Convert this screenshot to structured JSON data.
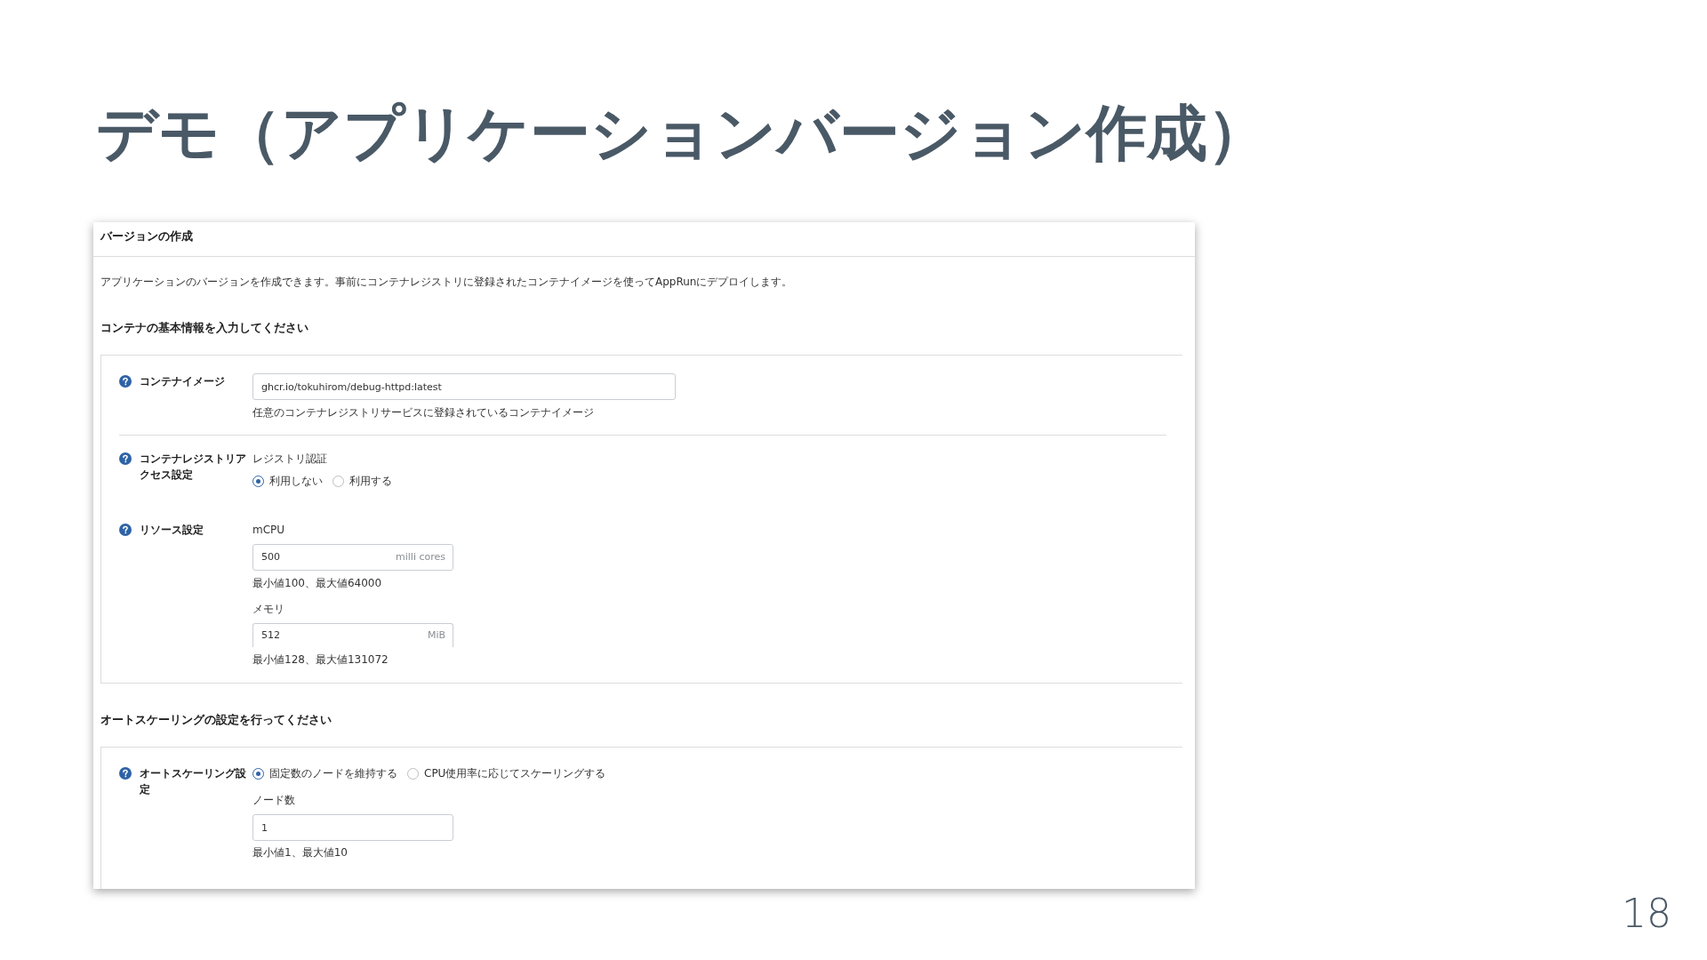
{
  "slide": {
    "title": "デモ（アプリケーションバージョン作成）",
    "page_number": "18"
  },
  "screenshot": {
    "header": "バージョンの作成",
    "description": "アプリケーションのバージョンを作成できます。事前にコンテナレジストリに登録されたコンテナイメージを使ってAppRunにデプロイします。",
    "sections": [
      {
        "heading": "コンテナの基本情報を入力してください",
        "fields": [
          {
            "kind": "text",
            "label": "コンテナイメージ",
            "value": "ghcr.io/tokuhirom/debug-httpd:latest",
            "help": "任意のコンテナレジストリサービスに登録されているコンテナイメージ",
            "separator_below": true
          },
          {
            "kind": "radio",
            "label": "コンテナレジストリアクセス設定",
            "sublabel": "レジストリ認証",
            "options": [
              {
                "label": "利用しない",
                "selected": true
              },
              {
                "label": "利用する",
                "selected": false
              }
            ],
            "separator_below": false
          },
          {
            "kind": "group",
            "label": "リソース設定",
            "inputs": [
              {
                "label": "mCPU",
                "value": "500",
                "unit": "milli cores",
                "help": "最小値100、最大値64000",
                "clipped": false
              },
              {
                "label": "メモリ",
                "value": "512",
                "unit": "MiB",
                "help": "最小値128、最大値131072",
                "clipped": true
              }
            ],
            "separator_below": false
          }
        ]
      },
      {
        "heading": "オートスケーリングの設定を行ってください",
        "fields": [
          {
            "kind": "radio",
            "label": "オートスケーリング設定",
            "options": [
              {
                "label": "固定数のノードを維持する",
                "selected": true
              },
              {
                "label": "CPU使用率に応じてスケーリングする",
                "selected": false
              }
            ],
            "inputs": [
              {
                "label": "ノード数",
                "value": "1",
                "help": "最小値1、最大値10",
                "clipped": false
              }
            ],
            "separator_below": false
          }
        ]
      }
    ]
  }
}
